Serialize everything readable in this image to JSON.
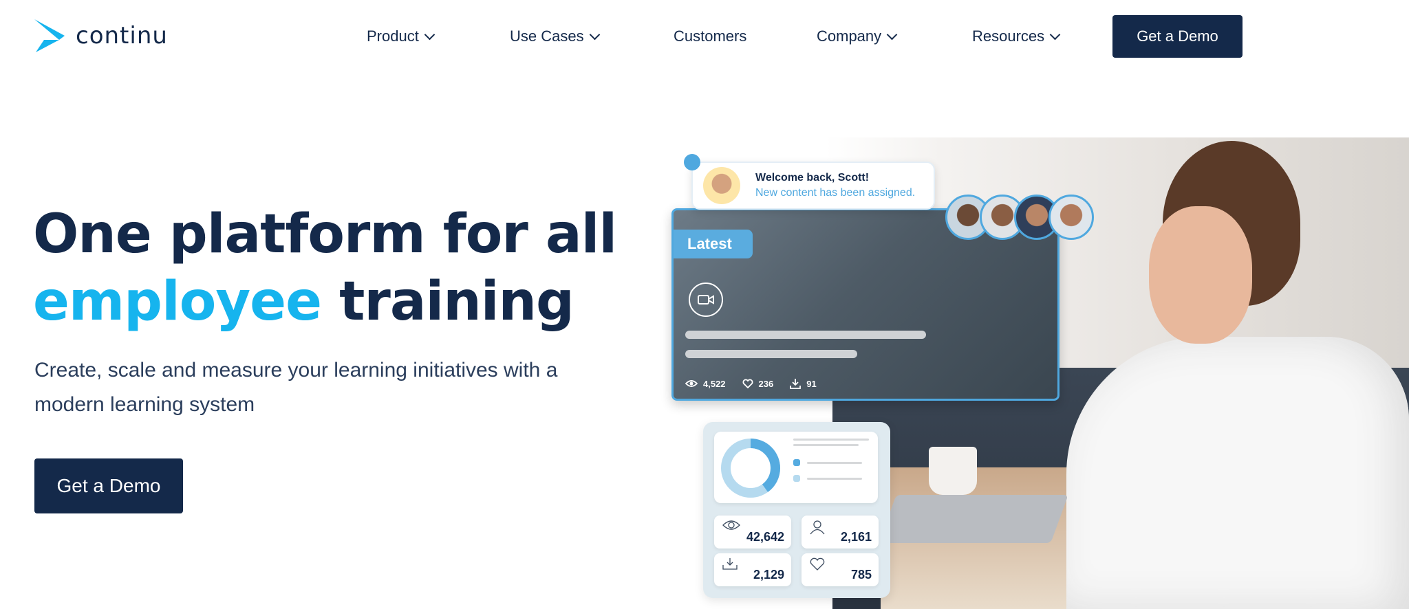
{
  "brand": {
    "name": "continu",
    "accent": "#16b4ee",
    "navy": "#14294a"
  },
  "nav": {
    "items": [
      {
        "label": "Product",
        "dropdown": true
      },
      {
        "label": "Use Cases",
        "dropdown": true
      },
      {
        "label": "Customers",
        "dropdown": false
      },
      {
        "label": "Company",
        "dropdown": true
      },
      {
        "label": "Resources",
        "dropdown": true
      }
    ],
    "cta": "Get a Demo"
  },
  "hero": {
    "line1": "One platform for all",
    "accent": "employee",
    "line2_rest": "training",
    "subtitle": "Create, scale and measure your learning initiatives with a modern learning system",
    "cta": "Get a Demo"
  },
  "notification": {
    "title": "Welcome back, Scott!",
    "subtitle": "New content has been assigned."
  },
  "video_card": {
    "badge": "Latest",
    "views": "4,522",
    "likes": "236",
    "downloads": "91"
  },
  "stats_card": {
    "donut_fraction": 0.4,
    "views": "42,642",
    "users": "2,161",
    "downloads": "2,129",
    "likes": "785"
  }
}
